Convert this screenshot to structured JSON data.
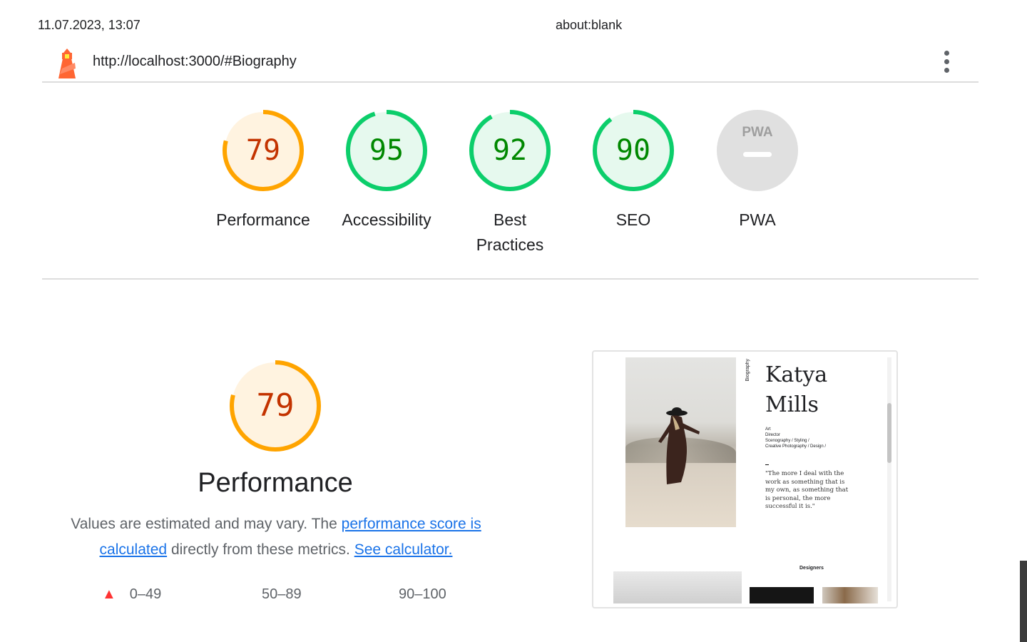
{
  "print_header": {
    "date": "11.07.2023, 13:07",
    "title": "about:blank"
  },
  "topbar": {
    "url": "http://localhost:3000/#Biography",
    "logo_icon": "lighthouse-icon",
    "menu_icon": "kebab-menu-icon"
  },
  "gauges": [
    {
      "id": "performance",
      "score": "79",
      "label": "Performance",
      "value": 79,
      "color": "#ffa400",
      "text_color": "#c33300",
      "bg": "#fff3e0"
    },
    {
      "id": "accessibility",
      "score": "95",
      "label": "Accessibility",
      "value": 95,
      "color": "#0cce6b",
      "text_color": "#008800",
      "bg": "#e6f9ee"
    },
    {
      "id": "best-practices",
      "score": "92",
      "label": "Best Practices",
      "value": 92,
      "color": "#0cce6b",
      "text_color": "#008800",
      "bg": "#e6f9ee"
    },
    {
      "id": "seo",
      "score": "90",
      "label": "SEO",
      "value": 90,
      "color": "#0cce6b",
      "text_color": "#008800",
      "bg": "#e6f9ee"
    },
    {
      "id": "pwa",
      "score": "",
      "label": "PWA",
      "badge": "PWA",
      "color": "#e0e0e0"
    }
  ],
  "performance": {
    "score": "79",
    "value": 79,
    "title": "Performance",
    "desc_prefix": "Values are estimated and may vary. The",
    "link_score": "performance score is calculated",
    "desc_middle": "directly from these metrics.",
    "link_calculator": "See calculator."
  },
  "legend": [
    {
      "range": "0–49",
      "icon": "fail-triangle-icon",
      "color": "#ff3333"
    },
    {
      "range": "50–89",
      "icon": "average-square-icon",
      "color": "#ffa400"
    },
    {
      "range": "90–100",
      "icon": "pass-circle-icon",
      "color": "#0cce6b"
    }
  ],
  "screenshot": {
    "vertical_label": "Biography",
    "name_line1": "Katya",
    "name_line2": "Mills",
    "roles": [
      "Art",
      "Director",
      "Scenography / Styling /",
      "Creative Photography / Design /"
    ],
    "quote": "\"The more I deal with the work as something that is my own, as something that is personal, the more successful it is.\"",
    "section_label": "Designers"
  }
}
